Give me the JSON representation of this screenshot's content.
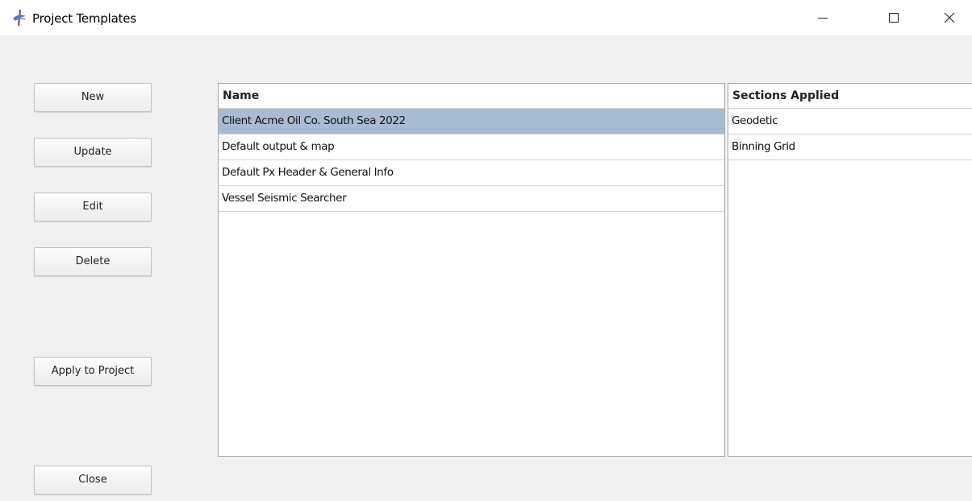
{
  "window": {
    "title": "Project Templates"
  },
  "buttons": {
    "new": "New",
    "update": "Update",
    "edit": "Edit",
    "delete": "Delete",
    "apply": "Apply to Project",
    "close": "Close"
  },
  "templates_table": {
    "header": "Name",
    "rows": [
      "Client Acme Oil Co. South Sea 2022",
      "Default output & map",
      "Default Px Header & General Info",
      "Vessel Seismic Searcher"
    ],
    "selected_index": 0,
    "selected_color": "#a8bbd2"
  },
  "sections_table": {
    "header": "Sections Applied",
    "rows": [
      "Geodetic",
      "Binning Grid"
    ]
  }
}
